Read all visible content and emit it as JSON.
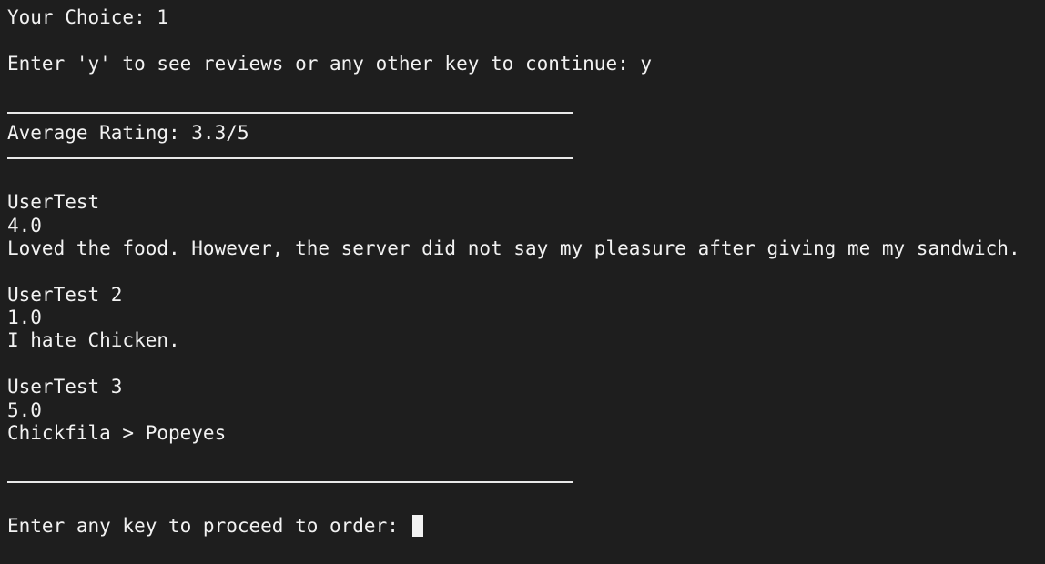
{
  "terminal": {
    "choice_line": "Your Choice: 1",
    "prompt_reviews": "Enter 'y' to see reviews or any other key to continue: y",
    "average_rating": "Average Rating: 3.3/5",
    "reviews": [
      {
        "user": "UserTest",
        "rating": "4.0",
        "text": "Loved the food. However, the server did not say my pleasure after giving me my sandwich."
      },
      {
        "user": "UserTest 2",
        "rating": "1.0",
        "text": "I hate Chicken."
      },
      {
        "user": "UserTest 3",
        "rating": "5.0",
        "text": "Chickfila > Popeyes"
      }
    ],
    "proceed_prompt": "Enter any key to proceed to order: "
  },
  "colors": {
    "background": "#1e1e1e",
    "foreground": "#f2f2f2"
  }
}
